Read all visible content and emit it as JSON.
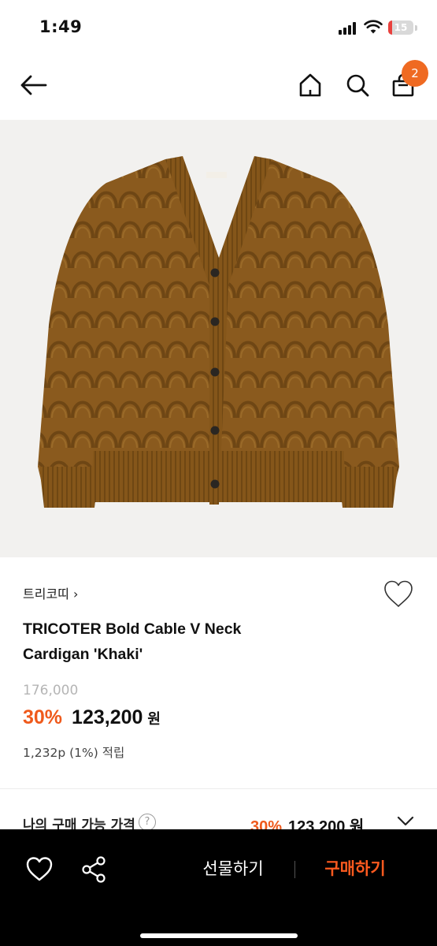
{
  "status_bar": {
    "time": "1:49",
    "battery": "15",
    "battery_level": 0.15,
    "icons": [
      "signal-icon",
      "wifi-icon",
      "battery-icon"
    ]
  },
  "header": {
    "icons": [
      "back-arrow-icon",
      "home-icon",
      "search-icon",
      "shopping-bag-icon"
    ],
    "cart_count": "2",
    "badge_color": "#ef6a22"
  },
  "product": {
    "image_subject": "khaki cable knit v-neck cardigan",
    "brand": "트리코띠",
    "brand_chevron": "›",
    "title_line1": "TRICOTER Bold Cable V Neck",
    "title_line2": "Cardigan 'Khaki'",
    "original_price": "176,000",
    "discount": "30%",
    "price": "123,200",
    "currency": "원",
    "points": "1,232p (1%) 적립"
  },
  "my_price": {
    "label": "나의 구매 가능 가격",
    "help": "?",
    "discount": "30%",
    "price": "123,200 원"
  },
  "bottom_bar": {
    "gift_label": "선물하기",
    "buy_label": "구매하기",
    "accent_color": "#ff5a1f"
  }
}
